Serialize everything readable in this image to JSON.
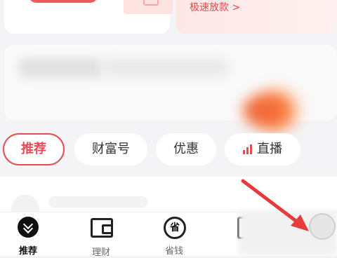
{
  "top_cards": {
    "left_button_label": "",
    "right_link_text": "极速放款 >"
  },
  "filter_tabs": [
    {
      "label": "推荐",
      "active": true
    },
    {
      "label": "财富号",
      "active": false
    },
    {
      "label": "优惠",
      "active": false
    },
    {
      "label": "直播",
      "active": false,
      "icon": "live-bars-icon"
    }
  ],
  "bottom_nav": [
    {
      "label": "推荐",
      "icon": "home-chevron-icon",
      "active": true
    },
    {
      "label": "理财",
      "icon": "wallet-icon",
      "active": false
    },
    {
      "label": "省钱",
      "icon": "save-money-icon",
      "icon_glyph": "省",
      "active": false
    },
    {
      "label": "",
      "icon": "box-icon",
      "active": false
    }
  ],
  "colors": {
    "accent": "#e64b51",
    "background": "#f4f4f6",
    "annotation_arrow": "#e53b3b"
  }
}
